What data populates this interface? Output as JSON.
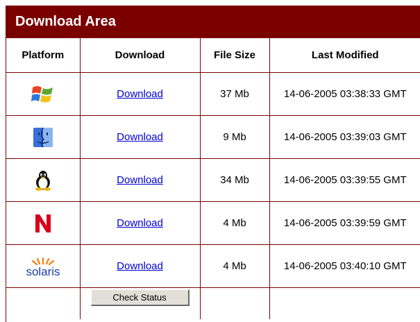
{
  "panel": {
    "title": "Download Area"
  },
  "table": {
    "headers": [
      "Platform",
      "Download",
      "File Size",
      "Last Modified"
    ],
    "rows": [
      {
        "platform_icon": "windows-icon",
        "link": "Download",
        "size": "37 Mb",
        "modified": "14-06-2005 03:38:33 GMT"
      },
      {
        "platform_icon": "mac-finder-icon",
        "link": "Download",
        "size": "9 Mb",
        "modified": "14-06-2005 03:39:03 GMT"
      },
      {
        "platform_icon": "linux-tux-icon",
        "link": "Download",
        "size": "34 Mb",
        "modified": "14-06-2005 03:39:55 GMT"
      },
      {
        "platform_icon": "netware-icon",
        "link": "Download",
        "size": "4 Mb",
        "modified": "14-06-2005 03:39:59 GMT"
      },
      {
        "platform_icon": "solaris-icon",
        "link": "Download",
        "size": "4 Mb",
        "modified": "14-06-2005 03:40:10 GMT"
      }
    ],
    "check_button_label": "Check Status"
  },
  "logos": {
    "solaris_text": "solaris"
  },
  "colors": {
    "accent": "#7a0000",
    "link": "#0000cc",
    "button_face": "#e2dfd8"
  }
}
